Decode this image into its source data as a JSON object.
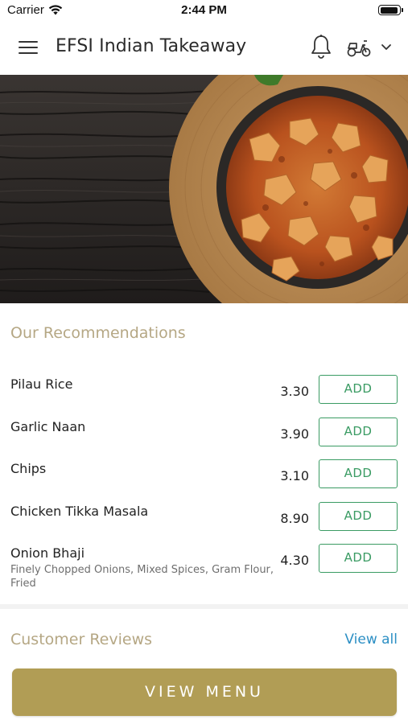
{
  "status_bar": {
    "carrier": "Carrier",
    "time": "2:44 PM"
  },
  "header": {
    "title": "EFSI Indian Takeaway",
    "icons": [
      "menu-icon",
      "bell-icon",
      "scooter-icon",
      "chevron-down-icon"
    ]
  },
  "hero": {
    "image": "curry-dish-photo"
  },
  "recommendations": {
    "title": "Our Recommendations",
    "items": [
      {
        "name": "Pilau Rice",
        "description": "",
        "price": "3.30",
        "button": "ADD"
      },
      {
        "name": "Garlic Naan",
        "description": "",
        "price": "3.90",
        "button": "ADD"
      },
      {
        "name": "Chips",
        "description": "",
        "price": "3.10",
        "button": "ADD"
      },
      {
        "name": "Chicken Tikka Masala",
        "description": "",
        "price": "8.90",
        "button": "ADD"
      },
      {
        "name": "Onion Bhaji",
        "description": "Finely Chopped Onions, Mixed Spices, Gram Flour, Fried",
        "price": "4.30",
        "button": "ADD"
      }
    ]
  },
  "reviews": {
    "title": "Customer Reviews",
    "view_all": "View all"
  },
  "footer": {
    "view_menu": "VIEW MENU"
  },
  "colors": {
    "accent_gold": "#b19d55",
    "section_title": "#b5a784",
    "add_green": "#3a9b63",
    "link_blue": "#2c8fc4"
  }
}
